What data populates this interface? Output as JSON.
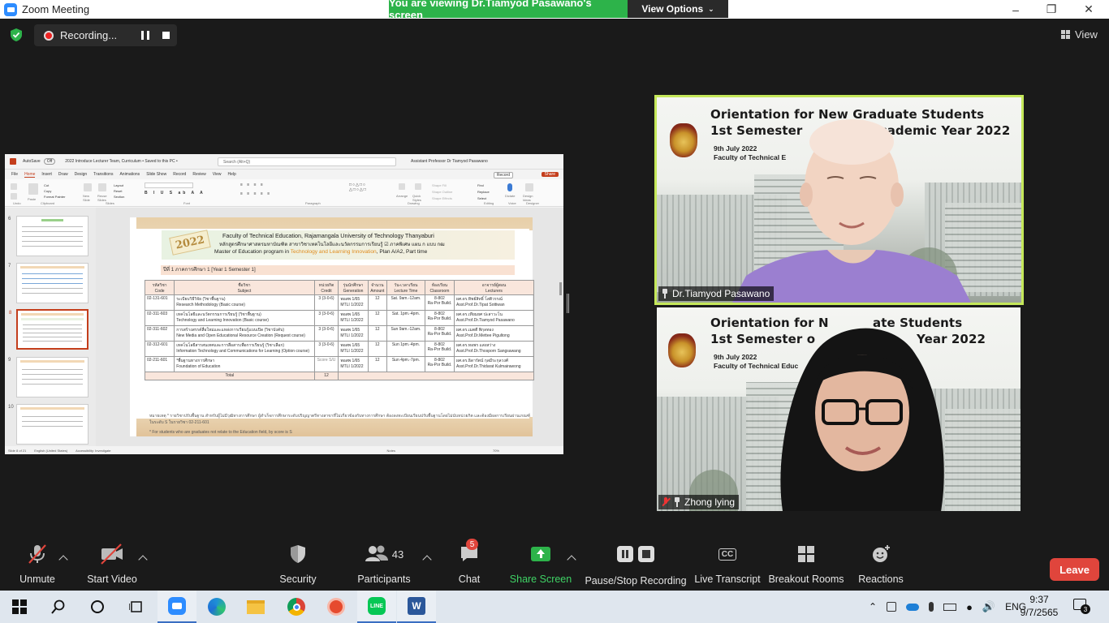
{
  "window": {
    "title": "Zoom Meeting",
    "banner": "You are viewing Dr.Tiamyod Pasawano's screen",
    "view_options": "View Options",
    "controls": [
      "–",
      "❐",
      "✕"
    ]
  },
  "recording": {
    "label": "Recording..."
  },
  "view_button": "View",
  "powerpoint": {
    "autosave": "AutoSave",
    "autosave_state": "Off",
    "doc_title": "2022 Introduce Lecturer Team, Curriculum • Saved to this PC •",
    "search_placeholder": "Search (Alt+Q)",
    "user": "Assistant Professor Dr Tiamyod Pasawano",
    "menu": [
      "File",
      "Home",
      "Insert",
      "Draw",
      "Design",
      "Transitions",
      "Animations",
      "Slide Show",
      "Record",
      "Review",
      "View",
      "Help"
    ],
    "record_btn": "Record",
    "share_btn": "Share",
    "ribbon_groups": [
      "Undo",
      "Clipboard",
      "Slides",
      "Font",
      "Paragraph",
      "Drawing",
      "Editing",
      "Voice",
      "Designer"
    ],
    "ribbon_items": [
      "Paste",
      "Cut",
      "Copy",
      "Format Painter",
      "New Slide",
      "Reuse Slides",
      "Layout",
      "Reset",
      "Section",
      "Arrange",
      "Quick Styles",
      "Shape Fill",
      "Shape Outline",
      "Shape Effects",
      "Find",
      "Replace",
      "Select",
      "Dictate",
      "Design Ideas"
    ],
    "thumb_numbers": [
      "6",
      "7",
      "8",
      "9",
      "10"
    ],
    "status": [
      "Slide 8 of 21",
      "English (United States)",
      "Accessibility: Investigate",
      "Notes",
      "70%"
    ]
  },
  "slide": {
    "year_badge": "2022",
    "line1": "Faculty of Technical Education, Rajamangala University of Technology Thanyaburi",
    "line2": "หลักสูตรศึกษาศาสตรมหาบัณฑิต  สาขาวิชาเทคโนโลยีและนวัตกรรมการเรียนรู้  ☑ ภาคพิเศษ  แผน ก แบบ กฒ",
    "line3_pre": "Master of Education program in ",
    "line3_hl": "Technology and Learning Innovation",
    "line3_post": ", Plan A/A2, Part time",
    "year_line": "ปีที่ 1 ภาคการศึกษา 1 [Year 1 Semester 1]",
    "headers": [
      [
        "รหัสวิชา",
        "Code"
      ],
      [
        "ชื่อวิชา",
        "Subject"
      ],
      [
        "หน่วยกิต",
        "Credit"
      ],
      [
        "รุ่นนักศึกษา",
        "Generation"
      ],
      [
        "จำนวน",
        "Amount"
      ],
      [
        "วัน-เวลาเรียน",
        "Lecture Time"
      ],
      [
        "ห้องเรียน",
        "Classroom"
      ],
      [
        "อาจารย์ผู้สอน",
        "Lecturers"
      ]
    ],
    "rows": [
      [
        "02-131-601",
        "ระเบียบวิธีวิจัย (วิชาพื้นฐาน)",
        "Research Methodology (Basic course)",
        "3 (3-0-6)",
        "พอสพ 1/65",
        "MTLI 1/2022",
        "12",
        "Sat. 9am.-12am.",
        "8-802",
        "Ra-Por Build.",
        "ผศ.ดร.ทิพย์สิทธิ์ โสติวรรณ์",
        "Asst.Prof.Dr.Tipat Sottiwan"
      ],
      [
        "02-311-603",
        "เทคโนโลยีและนวัตกรรมการเรียนรู้  (วิชาพื้นฐาน)",
        "Technology and Learning Innovation (Basic course)",
        "3 (3-0-6)",
        "พอสพ 1/65",
        "MTLI 1/2022",
        "12",
        "Sat. 1pm.-4pm.",
        "8-802",
        "Ra-Por Build.",
        "ผศ.ดร.เทียมยศ ปะสาวะโน",
        "Asst.Prof.Dr.Tiamyod Pasawano"
      ],
      [
        "02-311-602",
        "การสร้างสรรค์สื่อใหม่และแหล่งการเรียนรู้แบบเปิด (วิชาบังคับ)",
        "New Media and Open Educational Resource Creation (Request course)",
        "3 (3-0-6)",
        "พอสพ 1/65",
        "MTLI 1/2022",
        "12",
        "Sun 9am.-12am.",
        "8-802",
        "Ra-Por Build.",
        "ผศ.ดร.เมตตี พิกุลทอง",
        "Asst.Prof.Dr.Mettee Pigultong"
      ],
      [
        "02-312-601",
        "เทคโนโลยีสารสนเทศและการสื่อสารเพื่อการเรียนรู้ (วิชาเลือก)",
        "Information Technology and Communications for Learning (Option course)",
        "3 (3-0-6)",
        "พอสพ 1/65",
        "MTLI 1/2022",
        "12",
        "Sun 1pm.-4pm.",
        "8-802",
        "Ra-Por Build.",
        "ผศ.ดร.ทอพร แสงสว่าง",
        "Asst.Prof.Dr.Thosporn Sangsawang"
      ],
      [
        "02-211-601",
        "*พื้นฐานทางการศึกษา",
        "Foundation of Education",
        "Score S/U",
        "พอสพ 1/65",
        "MTLI 1/2022",
        "12",
        "Sun 4pm.-7pm.",
        "8-802",
        "Ra-Por Build.",
        "ผศ.ดร.ธิดารัตน์ กุลมีระกุลวงศ์",
        "Asst.Prof.Dr.Thidarat Kulmairawong"
      ]
    ],
    "total_label": "Total",
    "total_credit": "12",
    "note_th": "หมายเหตุ   * รายวิชาปรับพื้นฐาน สำหรับผู้ไม่มีวุฒิทางการศึกษา ผู้สำเร็จการศึกษาระดับปริญญาตรีทางสาขาที่ไม่เกี่ยวข้องกับทางการศึกษา ต้องลงทะเบียนเรียนปรับพื้นฐานโดยไม่นับหน่วยกิต และต้องมีผลการเรียนผ่านเกณฑ์  ในระดับ S ในรายวิชา 02-211-601",
    "note_en": "* For students who are graduates not relate to the Education field, by score is S"
  },
  "participants": {
    "presenter": {
      "name": "Dr.Tiamyod Pasawano",
      "bg_title1": "Orientation for New Graduate Students",
      "bg_title2": "1st Semester",
      "bg_title2_right": "Academic Year 2022",
      "bg_sub1": "9th July 2022",
      "bg_sub2": "Faculty of Technical E"
    },
    "second": {
      "name": "Zhong lying",
      "bg_title1": "Orientation for N",
      "bg_title1_right": "ate Students",
      "bg_title2": "1st Semester o",
      "bg_title2_right": "Year 2022",
      "bg_sub1": "9th July 2022",
      "bg_sub2": "Faculty of Technical Educ"
    }
  },
  "toolbar": {
    "unmute": "Unmute",
    "start_video": "Start Video",
    "security": "Security",
    "participants": "Participants",
    "participant_count": "43",
    "chat": "Chat",
    "chat_badge": "5",
    "share_screen": "Share Screen",
    "pause_stop_recording": "Pause/Stop Recording",
    "cc_icon_text": "CC",
    "live_transcript": "Live Transcript",
    "breakout_rooms": "Breakout Rooms",
    "reactions": "Reactions",
    "leave": "Leave"
  },
  "taskbar": {
    "apps": [
      "start-icon",
      "search-icon",
      "cortana-icon",
      "task-view-icon",
      "zoom-icon",
      "edge-icon",
      "file-explorer-icon",
      "chrome-icon",
      "app-red-icon",
      "line-icon",
      "word-icon"
    ],
    "line_label": "LINE",
    "word_label": "W",
    "language": "ENG",
    "time": "9:37",
    "date": "9/7/2565",
    "notification_count": "3"
  },
  "colors": {
    "zoom_green": "#2db34a",
    "active_speaker_border": "#c5e85a",
    "leave_red": "#e0453c",
    "zoom_blue": "#2d8cff",
    "ppt_orange": "#c43e1c"
  }
}
